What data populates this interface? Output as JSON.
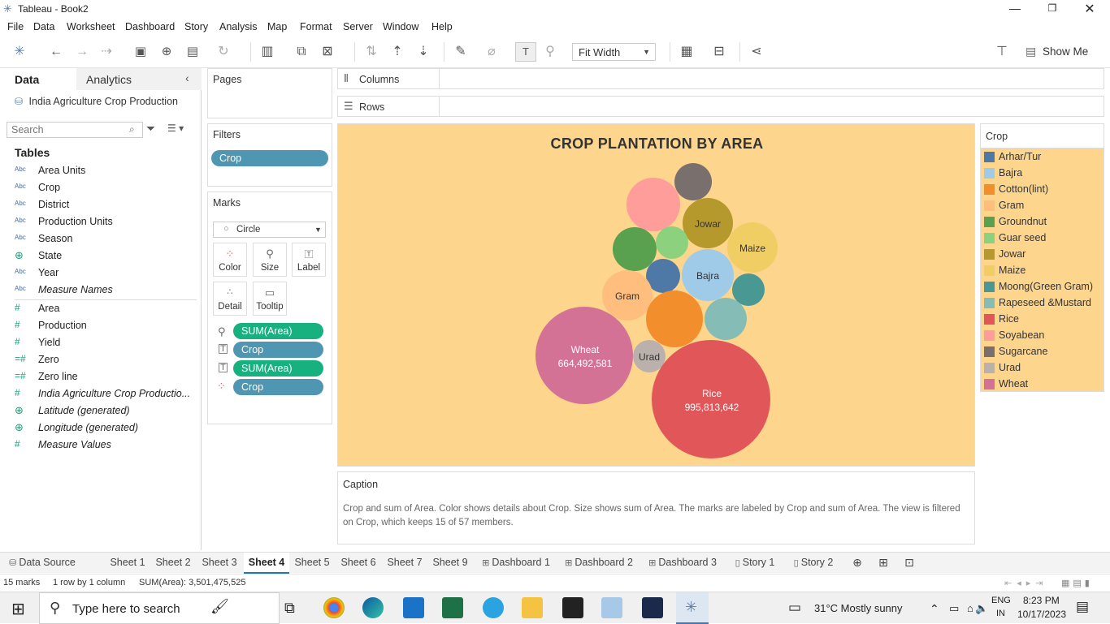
{
  "window": {
    "title": "Tableau - Book2"
  },
  "menu": [
    "File",
    "Data",
    "Worksheet",
    "Dashboard",
    "Story",
    "Analysis",
    "Map",
    "Format",
    "Server",
    "Window",
    "Help"
  ],
  "toolbar": {
    "fit_value": "Fit Width",
    "show_me": "Show Me"
  },
  "datapane": {
    "tab_data": "Data",
    "tab_analytics": "Analytics",
    "datasource": "India Agriculture Crop Production",
    "search_placeholder": "Search",
    "tables_heading": "Tables",
    "dimensions": [
      {
        "type": "Abc",
        "name": "Area Units"
      },
      {
        "type": "Abc",
        "name": "Crop"
      },
      {
        "type": "Abc",
        "name": "District"
      },
      {
        "type": "Abc",
        "name": "Production Units"
      },
      {
        "type": "Abc",
        "name": "Season"
      },
      {
        "type": "globe",
        "name": "State"
      },
      {
        "type": "Abc",
        "name": "Year"
      },
      {
        "type": "Abc",
        "name": "Measure Names"
      }
    ],
    "measures": [
      {
        "type": "#",
        "name": "Area"
      },
      {
        "type": "#",
        "name": "Production"
      },
      {
        "type": "#",
        "name": "Yield"
      },
      {
        "type": "=#",
        "name": "Zero"
      },
      {
        "type": "=#",
        "name": "Zero line"
      },
      {
        "type": "#",
        "name": "India Agriculture Crop Productio..."
      },
      {
        "type": "globe",
        "name": "Latitude (generated)"
      },
      {
        "type": "globe",
        "name": "Longitude (generated)"
      },
      {
        "type": "#",
        "name": "Measure Values"
      }
    ]
  },
  "cards": {
    "pages": "Pages",
    "filters": "Filters",
    "filter_pill": "Crop",
    "marks": "Marks",
    "mark_type": "Circle",
    "mark_buttons": [
      "Color",
      "Size",
      "Label",
      "Detail",
      "Tooltip"
    ],
    "mark_pills": [
      "SUM(Area)",
      "Crop",
      "SUM(Area)",
      "Crop"
    ]
  },
  "shelves": {
    "columns": "Columns",
    "rows": "Rows"
  },
  "viz": {
    "title": "CROP PLANTATION BY AREA",
    "bubbles": [
      {
        "crop": "Rice",
        "label": "Rice",
        "value": "995,813,642",
        "color": "#e15759"
      },
      {
        "crop": "Wheat",
        "label": "Wheat",
        "value": "664,492,581",
        "color": "#d37295"
      },
      {
        "crop": "Urad",
        "label": "Urad",
        "value": "",
        "color": "#bab0ac"
      },
      {
        "crop": "Gram",
        "label": "Gram",
        "value": "",
        "color": "#ffbe7d"
      },
      {
        "crop": "Bajra",
        "label": "Bajra",
        "value": "",
        "color": "#a0cbe8"
      },
      {
        "crop": "Jowar",
        "label": "Jowar",
        "value": "",
        "color": "#b6992d"
      },
      {
        "crop": "Maize",
        "label": "Maize",
        "value": "",
        "color": "#f1ce63"
      }
    ]
  },
  "legend": {
    "title": "Crop",
    "items": [
      {
        "name": "Arhar/Tur",
        "color": "#4e79a7"
      },
      {
        "name": "Bajra",
        "color": "#a0cbe8"
      },
      {
        "name": "Cotton(lint)",
        "color": "#f28e2b"
      },
      {
        "name": "Gram",
        "color": "#ffbe7d"
      },
      {
        "name": "Groundnut",
        "color": "#59a14f"
      },
      {
        "name": "Guar seed",
        "color": "#8cd17d"
      },
      {
        "name": "Jowar",
        "color": "#b6992d"
      },
      {
        "name": "Maize",
        "color": "#f1ce63"
      },
      {
        "name": "Moong(Green Gram)",
        "color": "#499894"
      },
      {
        "name": "Rapeseed &Mustard",
        "color": "#86bcb6"
      },
      {
        "name": "Rice",
        "color": "#e15759"
      },
      {
        "name": "Soyabean",
        "color": "#ff9d9a"
      },
      {
        "name": "Sugarcane",
        "color": "#79706e"
      },
      {
        "name": "Urad",
        "color": "#bab0ac"
      },
      {
        "name": "Wheat",
        "color": "#d37295"
      }
    ]
  },
  "caption": {
    "label": "Caption",
    "text": "Crop and sum of Area.  Color shows details about Crop.  Size shows sum of Area.  The marks are labeled by Crop and sum of Area. The view is filtered on Crop, which keeps 15 of 57 members."
  },
  "sheet_tabs": [
    "Data Source",
    "Sheet 1",
    "Sheet 2",
    "Sheet 3",
    "Sheet 4",
    "Sheet 5",
    "Sheet 6",
    "Sheet 7",
    "Sheet 9",
    "Dashboard 1",
    "Dashboard 2",
    "Dashboard 3",
    "Story 1",
    "Story 2"
  ],
  "active_sheet": "Sheet 4",
  "status": {
    "marks": "15 marks",
    "dims": "1 row by 1 column",
    "sum": "SUM(Area): 3,501,475,525"
  },
  "taskbar": {
    "search_placeholder": "Type here to search",
    "weather": "31°C  Mostly sunny",
    "lang1": "ENG",
    "lang2": "IN",
    "time": "8:23 PM",
    "date": "10/17/2023"
  }
}
